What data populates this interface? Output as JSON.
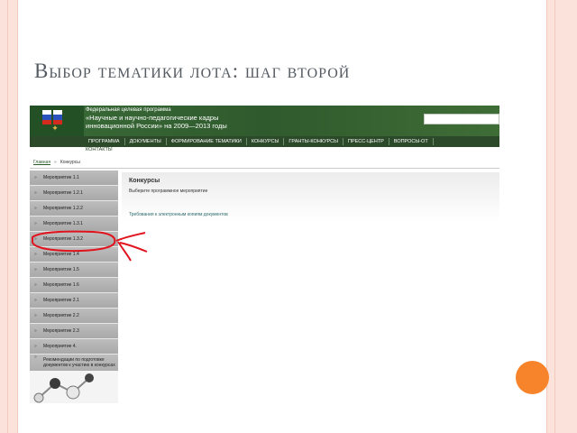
{
  "slide": {
    "title": "Выбор тематики лота: шаг второй"
  },
  "banner": {
    "small_text": "Федеральная целевая программа",
    "line1": "«Научные и научно-педагогические кадры",
    "line2": "инновационной России» на 2009—2013 годы"
  },
  "nav": {
    "items": [
      "ПРОГРАММА",
      "ДОКУМЕНТЫ",
      "ФОРМИРОВАНИЕ ТЕМАТИКИ",
      "КОНКУРСЫ",
      "ГРАНТЫ-КОНКУРСЫ",
      "ПРЕСС-ЦЕНТР",
      "ВОПРОСЫ-ОТ",
      "КОНТАКТЫ"
    ]
  },
  "breadcrumb": {
    "home": "Главная",
    "separator": "»",
    "current": "Конкурсы"
  },
  "sidebar": {
    "items": [
      "Мероприятие 1.1",
      "Мероприятие 1.2.1",
      "Мероприятие 1.2.2",
      "Мероприятие 1.3.1",
      "Мероприятие 1.3.2",
      "Мероприятие 1.4",
      "Мероприятие 1.5",
      "Мероприятие 1.6",
      "Мероприятие 2.1",
      "Мероприятие 2.2",
      "Мероприятие 2.3",
      "Мероприятие 4.",
      "Рекомендации по подготовке документов к участию в конкурсах"
    ]
  },
  "content": {
    "title": "Конкурсы",
    "subtitle": "Выберите программное мероприятие",
    "link": "Требования к электронным копиям документов"
  },
  "colors": {
    "banner_green": "#2f5a2d",
    "nav_green": "#2c4a2a",
    "highlight_red": "#e0141e",
    "orange_accent": "#f7842a"
  }
}
